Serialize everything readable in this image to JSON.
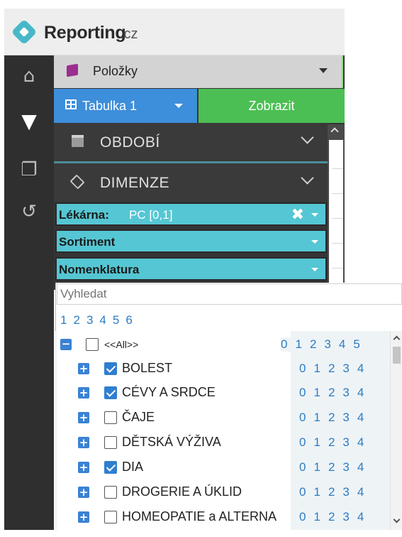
{
  "brand": {
    "name": "Reporting",
    "suffix": ".cz",
    "accent": "#47b8c7"
  },
  "rail": {
    "items": [
      {
        "name": "home-icon",
        "glyph": "⌂"
      },
      {
        "name": "filter-icon",
        "glyph": "▼"
      },
      {
        "name": "copy-icon",
        "glyph": "❐"
      },
      {
        "name": "history-icon",
        "glyph": "↺"
      }
    ]
  },
  "toolbar": {
    "items_label": "Položky",
    "table_label": "Tabulka 1",
    "show_label": "Zobrazit"
  },
  "sections": {
    "period": "OBDOBÍ",
    "dimensions": "DIMENZE"
  },
  "filters": [
    {
      "label": "Lékárna:",
      "value": "PC [0,1]",
      "clearable": true
    },
    {
      "label": "Sortiment",
      "value": ""
    },
    {
      "label": "Nomenklatura",
      "value": ""
    }
  ],
  "search": {
    "placeholder": "Vyhledat"
  },
  "pager": [
    "1",
    "2",
    "3",
    "4",
    "5",
    "6"
  ],
  "tree": {
    "all_label": "<<All>>",
    "all_levels": [
      "0",
      "1",
      "2",
      "3",
      "4",
      "5"
    ],
    "row_levels": [
      "0",
      "1",
      "2",
      "3",
      "4"
    ],
    "items": [
      {
        "label": "BOLEST",
        "checked": true
      },
      {
        "label": "CÉVY A SRDCE",
        "checked": true
      },
      {
        "label": "ČAJE",
        "checked": false
      },
      {
        "label": "DĚTSKÁ VÝŽIVA",
        "checked": false
      },
      {
        "label": "DIA",
        "checked": true
      },
      {
        "label": "DROGERIE A ÚKLID",
        "checked": false
      },
      {
        "label": "HOMEOPATIE a ALTERNA",
        "checked": false
      }
    ]
  },
  "colors": {
    "rail": "#2f2f2f",
    "filter_row": "#55c6d3",
    "table_button": "#3d8edb",
    "show_button": "#4cbf54",
    "checkbox_on": "#2f7fd0"
  }
}
